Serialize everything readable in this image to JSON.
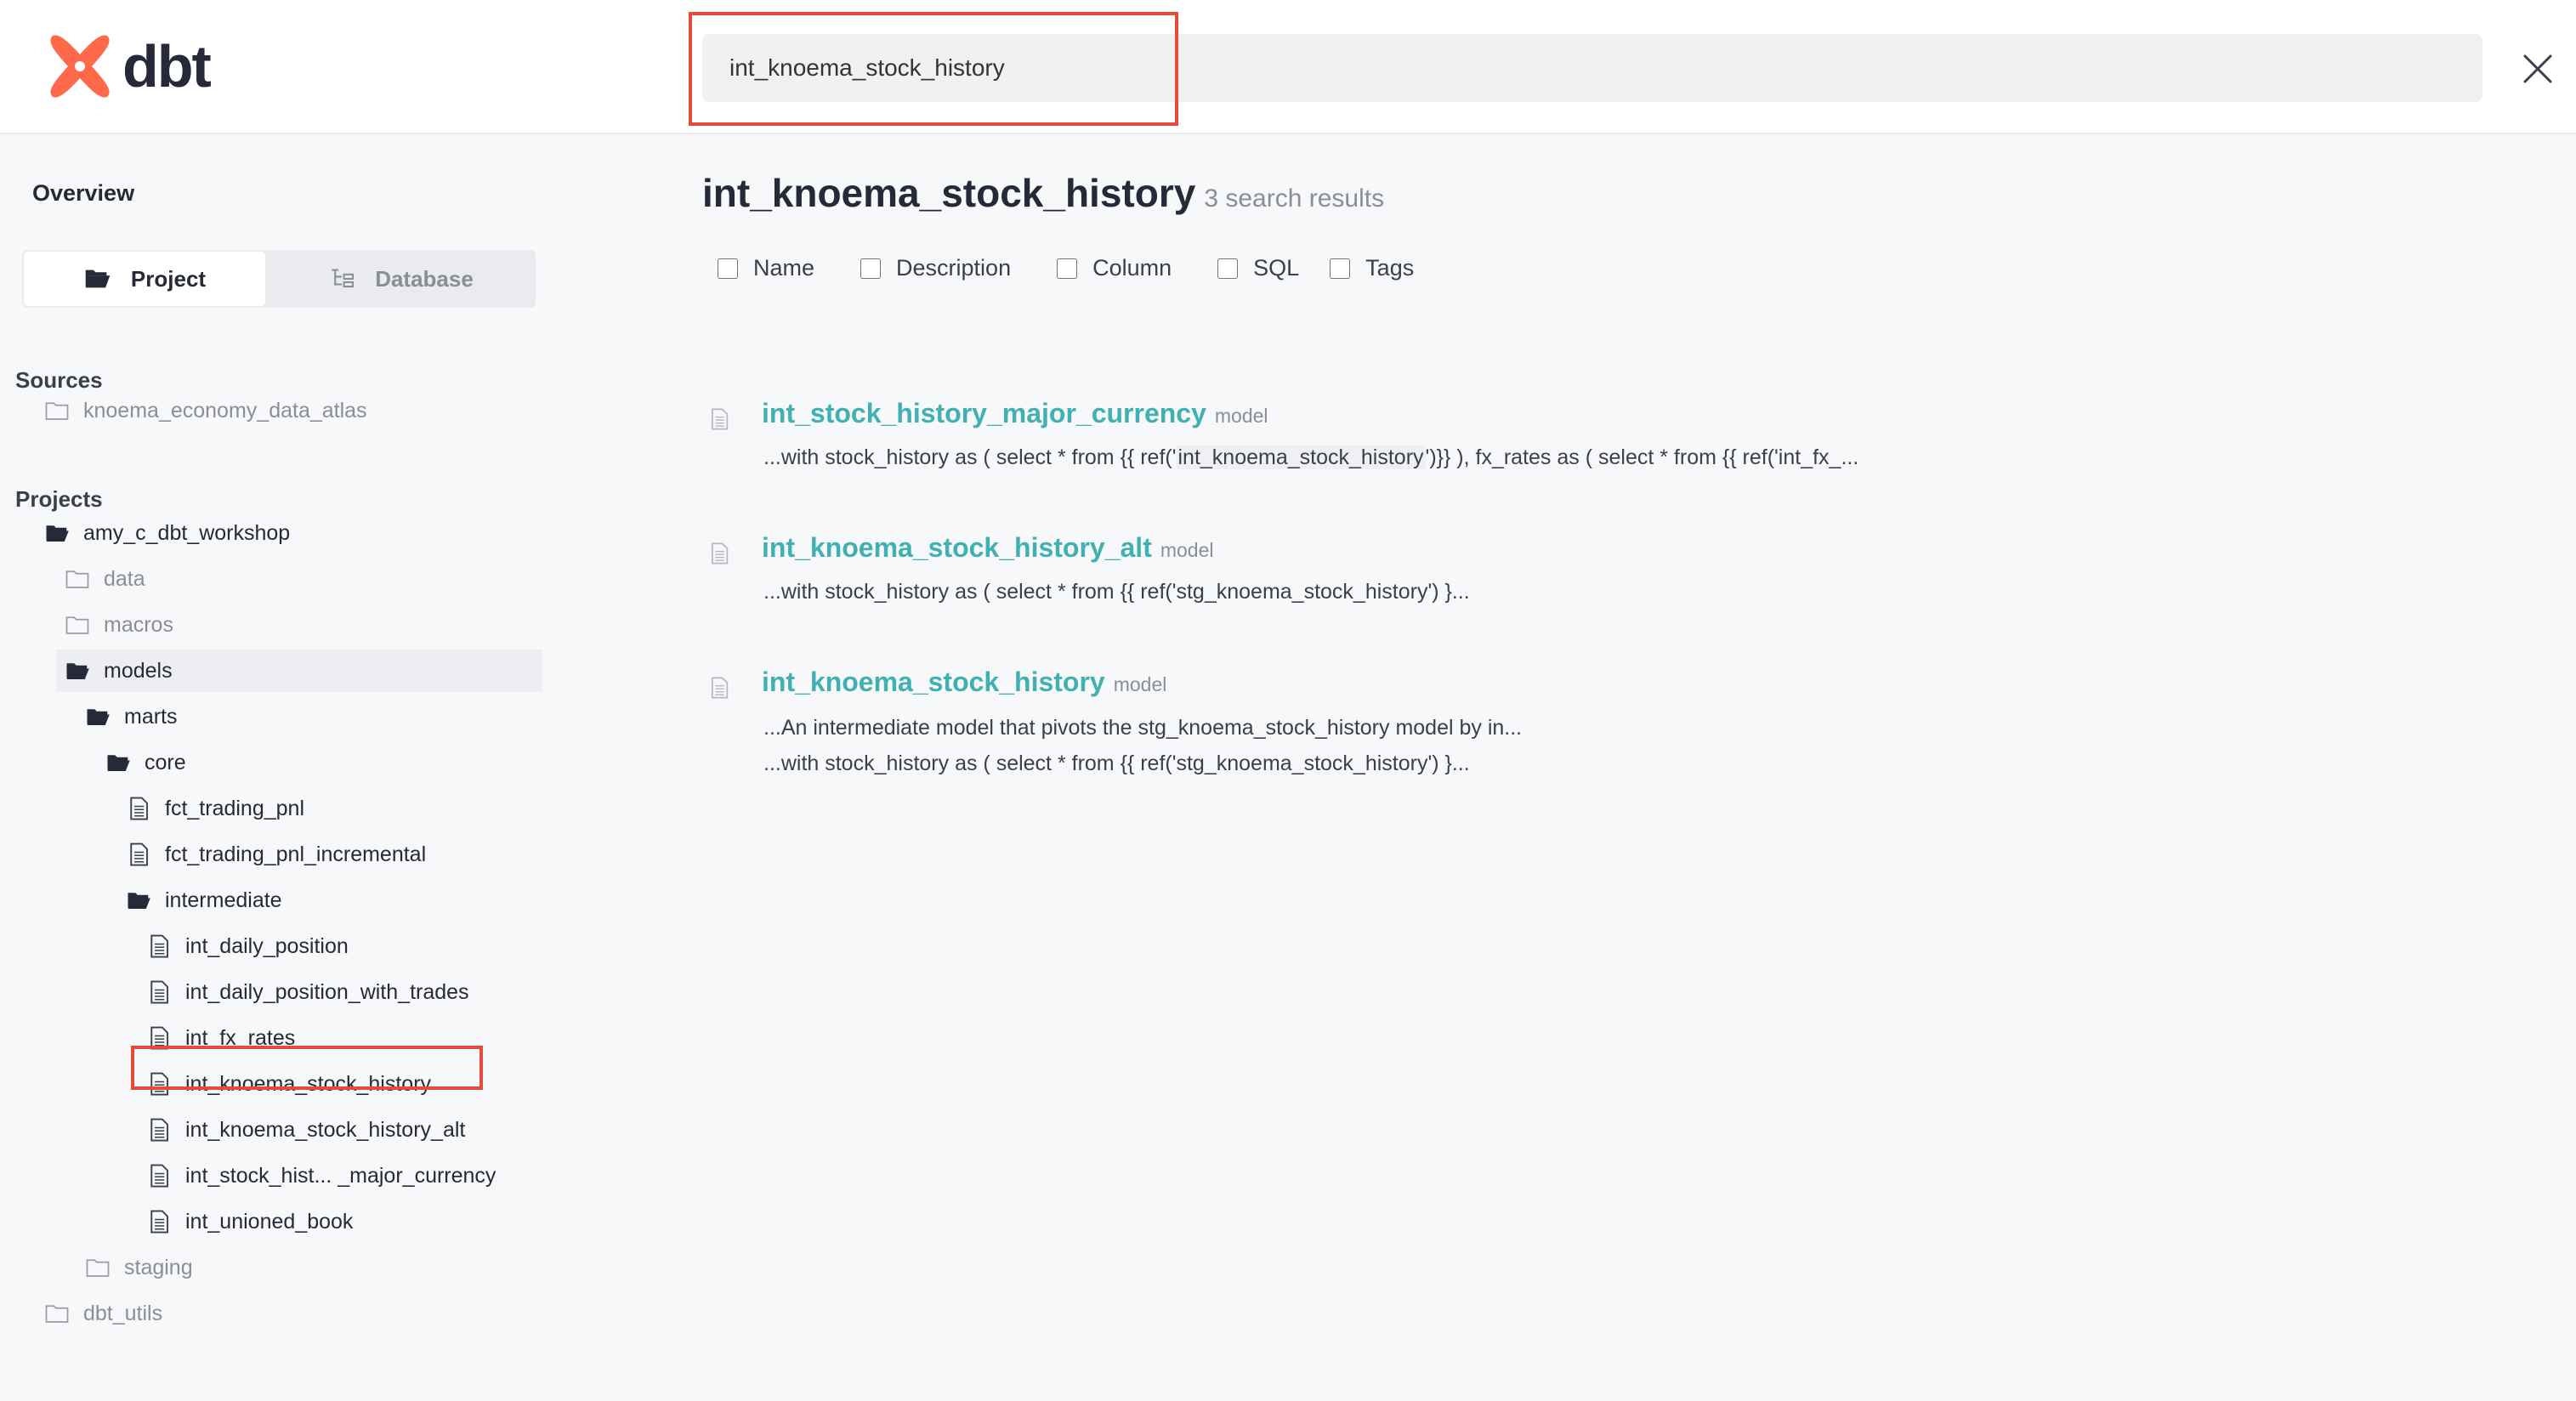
{
  "app": {
    "logo_text": "dbt",
    "brand_color": "#ff694a",
    "accent_color": "#40b0b1",
    "highlight_color": "#e54b3c"
  },
  "search": {
    "value": "int_knoema_stock_history",
    "placeholder": ""
  },
  "sidebar": {
    "overview_label": "Overview",
    "tabs": [
      {
        "label": "Project",
        "icon": "folder-open-icon"
      },
      {
        "label": "Database",
        "icon": "tree-icon"
      }
    ],
    "sources_label": "Sources",
    "sources": [
      {
        "label": "knoema_economy_data_atlas",
        "icon": "folder-icon"
      }
    ],
    "projects_label": "Projects",
    "tree": [
      {
        "label": "amy_c_dbt_workshop",
        "icon": "folder-open-icon"
      },
      {
        "label": "data",
        "icon": "folder-icon"
      },
      {
        "label": "macros",
        "icon": "folder-icon"
      },
      {
        "label": "models",
        "icon": "folder-open-icon"
      },
      {
        "label": "marts",
        "icon": "folder-open-icon"
      },
      {
        "label": "core",
        "icon": "folder-open-icon"
      },
      {
        "label": "fct_trading_pnl",
        "icon": "file-icon"
      },
      {
        "label": "fct_trading_pnl_incremental",
        "icon": "file-icon"
      },
      {
        "label": "intermediate",
        "icon": "folder-open-icon"
      },
      {
        "label": "int_daily_position",
        "icon": "file-icon"
      },
      {
        "label": "int_daily_position_with_trades",
        "icon": "file-icon"
      },
      {
        "label": "int_fx_rates",
        "icon": "file-icon"
      },
      {
        "label": "int_knoema_stock_history",
        "icon": "file-icon"
      },
      {
        "label": "int_knoema_stock_history_alt",
        "icon": "file-icon"
      },
      {
        "label": "int_stock_hist... _major_currency",
        "icon": "file-icon"
      },
      {
        "label": "int_unioned_book",
        "icon": "file-icon"
      },
      {
        "label": "staging",
        "icon": "folder-icon"
      },
      {
        "label": "dbt_utils",
        "icon": "folder-icon"
      }
    ]
  },
  "main": {
    "title": "int_knoema_stock_history",
    "count": "3 search results",
    "filters": [
      "Name",
      "Description",
      "Column",
      "SQL",
      "Tags"
    ],
    "results": [
      {
        "name": "int_stock_history_major_currency",
        "type": "model",
        "snippet1_pre": "...with stock_history as ( select * from {{ ref('",
        "snippet1_hl": "int_knoema_stock_history",
        "snippet1_post": "')}} ), fx_rates as ( select * from {{ ref('int_fx_..."
      },
      {
        "name": "int_knoema_stock_history_alt",
        "type": "model",
        "snippet1": "...with stock_history as ( select * from {{ ref('stg_knoema_stock_history') }..."
      },
      {
        "name": "int_knoema_stock_history",
        "type": "model",
        "snippet1": "...An intermediate model that pivots the stg_knoema_stock_history model by in...",
        "snippet2": "...with stock_history as ( select * from {{ ref('stg_knoema_stock_history') }..."
      }
    ]
  }
}
